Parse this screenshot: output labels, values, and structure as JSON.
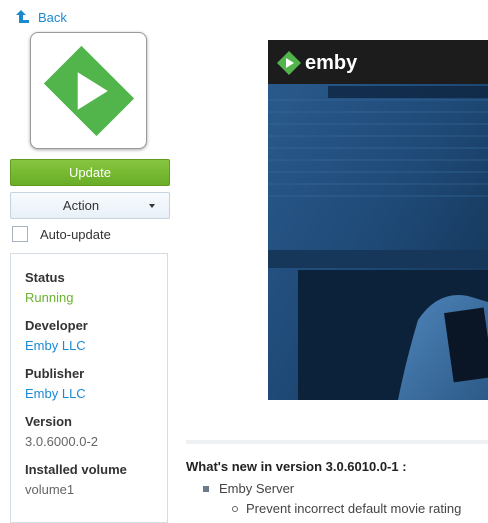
{
  "nav": {
    "back_label": "Back"
  },
  "app": {
    "icon": "emby-logo-icon",
    "brand_color": "#52b54b"
  },
  "buttons": {
    "update_label": "Update",
    "action_label": "Action"
  },
  "auto_update": {
    "label": "Auto-update",
    "checked": false
  },
  "info": [
    {
      "key": "Status",
      "value": "Running"
    },
    {
      "key": "Developer",
      "value": "Emby LLC"
    },
    {
      "key": "Publisher",
      "value": "Emby LLC"
    },
    {
      "key": "Version",
      "value": "3.0.6000.0-2"
    },
    {
      "key": "Installed volume",
      "value": "volume1"
    },
    {
      "key": "URL",
      "value": ""
    }
  ],
  "preview": {
    "brand_text": "emby"
  },
  "release_notes": {
    "heading": "What's new in version 3.0.6010.0-1 :",
    "items": [
      {
        "label": "Emby Server",
        "subitems": [
          "Prevent incorrect default movie rating"
        ]
      }
    ]
  },
  "colors": {
    "accent": "#1a8ad0",
    "update_button": "#76b82a",
    "status_running": "#6bb32f"
  }
}
